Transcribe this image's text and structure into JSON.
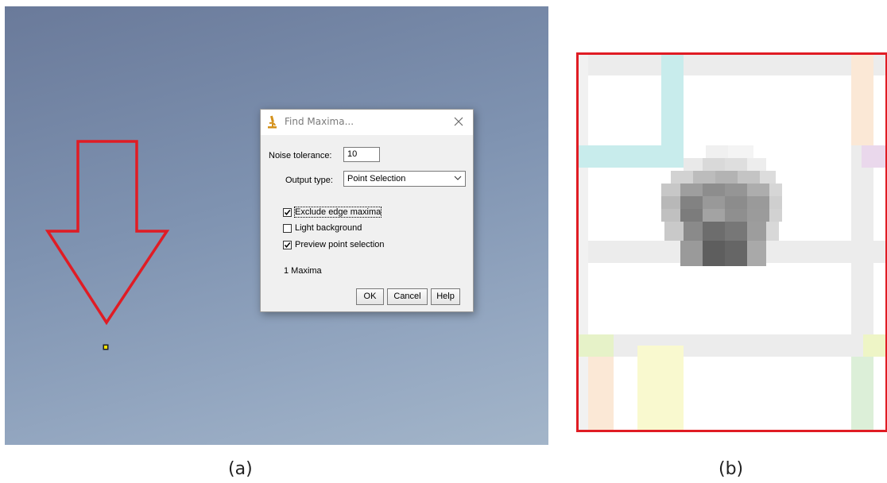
{
  "dialog": {
    "title": "Find Maxima...",
    "noise_tolerance_label": "Noise tolerance:",
    "noise_tolerance_value": "10",
    "output_type_label": "Output type:",
    "output_type_value": "Point Selection",
    "checkboxes": [
      {
        "label": "Exclude edge maxima",
        "checked": true
      },
      {
        "label": "Light background",
        "checked": false
      },
      {
        "label": "Preview point selection",
        "checked": true
      }
    ],
    "result_text": "1 Maxima",
    "buttons": {
      "ok": "OK",
      "cancel": "Cancel",
      "help": "Help"
    }
  },
  "captions": {
    "a": "(a)",
    "b": "(b)"
  },
  "colors": {
    "annotation_red": "#e01c24",
    "background_top": "#6a7a9a",
    "background_bottom": "#a3b5c9"
  },
  "icons": {
    "title": "microscope-icon",
    "close": "close-icon",
    "dropdown": "chevron-down-icon",
    "arrow": "down-arrow-annotation",
    "point": "point-selection-marker"
  }
}
